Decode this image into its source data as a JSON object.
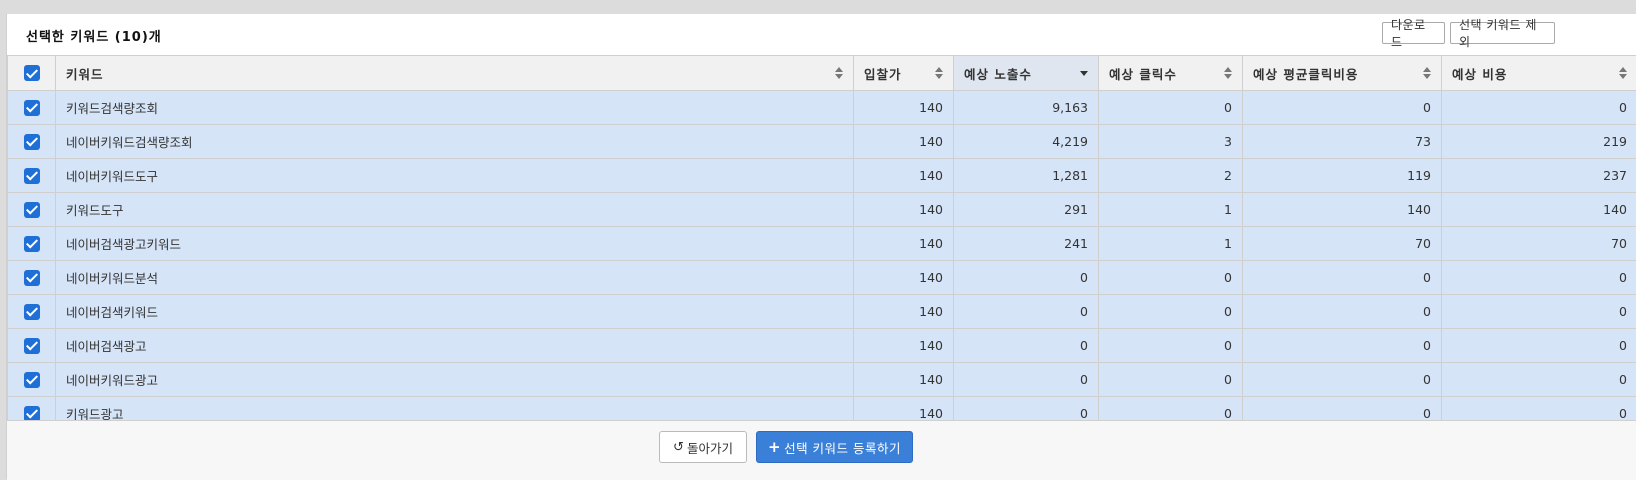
{
  "panel": {
    "title": "선택한 키워드 (10)개",
    "download_label": "다운로드",
    "remove_label": "선택 키워드 제외"
  },
  "table": {
    "columns": [
      "키워드",
      "입찰가",
      "예상 노출수",
      "예상 클릭수",
      "예상 평균클릭비용",
      "예상 비용"
    ],
    "sorted_column": "예상 노출수",
    "sort_direction": "desc",
    "rows": [
      {
        "keyword": "키워드검색량조회",
        "bid": "140",
        "impressions": "9,163",
        "clicks": "0",
        "cpc": "0",
        "cost": "0",
        "checked": true
      },
      {
        "keyword": "네이버키워드검색량조회",
        "bid": "140",
        "impressions": "4,219",
        "clicks": "3",
        "cpc": "73",
        "cost": "219",
        "checked": true
      },
      {
        "keyword": "네이버키워드도구",
        "bid": "140",
        "impressions": "1,281",
        "clicks": "2",
        "cpc": "119",
        "cost": "237",
        "checked": true
      },
      {
        "keyword": "키워드도구",
        "bid": "140",
        "impressions": "291",
        "clicks": "1",
        "cpc": "140",
        "cost": "140",
        "checked": true
      },
      {
        "keyword": "네이버검색광고키워드",
        "bid": "140",
        "impressions": "241",
        "clicks": "1",
        "cpc": "70",
        "cost": "70",
        "checked": true
      },
      {
        "keyword": "네이버키워드분석",
        "bid": "140",
        "impressions": "0",
        "clicks": "0",
        "cpc": "0",
        "cost": "0",
        "checked": true
      },
      {
        "keyword": "네이버검색키워드",
        "bid": "140",
        "impressions": "0",
        "clicks": "0",
        "cpc": "0",
        "cost": "0",
        "checked": true
      },
      {
        "keyword": "네이버검색광고",
        "bid": "140",
        "impressions": "0",
        "clicks": "0",
        "cpc": "0",
        "cost": "0",
        "checked": true
      },
      {
        "keyword": "네이버키워드광고",
        "bid": "140",
        "impressions": "0",
        "clicks": "0",
        "cpc": "0",
        "cost": "0",
        "checked": true
      },
      {
        "keyword": "키워드광고",
        "bid": "140",
        "impressions": "0",
        "clicks": "0",
        "cpc": "0",
        "cost": "0",
        "checked": true
      }
    ]
  },
  "footer": {
    "back_label": "돌아가기",
    "register_label": "선택 키워드 등록하기"
  },
  "colors": {
    "accent": "#3a7fd8",
    "checkbox": "#1e6fd6",
    "row_bg": "#d6e4f8",
    "sorted_header_bg": "#dfe6ef"
  },
  "icons": {
    "back": "undo-icon",
    "register": "plus-icon"
  }
}
